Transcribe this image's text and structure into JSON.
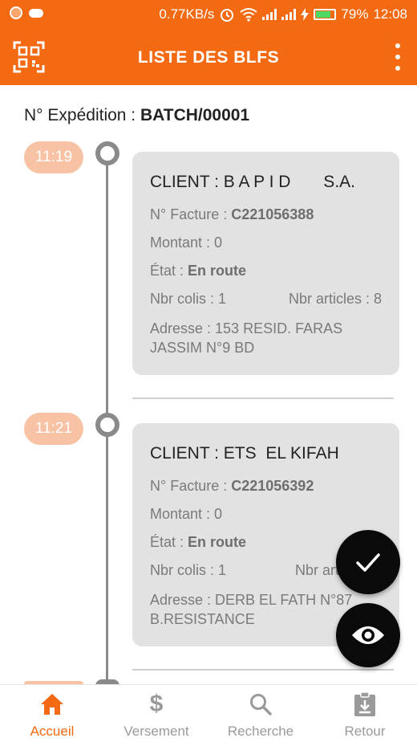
{
  "status_bar": {
    "speed": "0.77KB/s",
    "battery": "79%",
    "time": "12:08"
  },
  "app_bar": {
    "title": "LISTE DES BLFS",
    "qr_icon": "qr-code-icon",
    "menu_icon": "more-vert-icon"
  },
  "header": {
    "expedition_label": "N° Expédition : ",
    "expedition_value": "BATCH/00001"
  },
  "entries": [
    {
      "time": "11:19",
      "client": "CLIENT : B A P I D       S.A.",
      "facture_label": "N° Facture : ",
      "facture_value": "C221056388",
      "montant": "Montant : 0",
      "etat_label": "État : ",
      "etat_value": "En route",
      "nbr_colis": "Nbr colis : 1",
      "nbr_articles": "Nbr articles : 8",
      "adresse_line1": "Adresse : 153 RESID. FARAS",
      "adresse_line2": "JASSIM N°9 BD"
    },
    {
      "time": "11:21",
      "client": "CLIENT : ETS  EL KIFAH",
      "facture_label": "N° Facture : ",
      "facture_value": "C221056392",
      "montant": "Montant : 0",
      "etat_label": "État : ",
      "etat_value": "En route",
      "nbr_colis": "Nbr colis : 1",
      "nbr_articles": "Nbr artic",
      "adresse_line1": "Adresse : DERB EL FATH N°87",
      "adresse_line2": "B.RESISTANCE"
    }
  ],
  "fabs": {
    "validate_icon": "check-icon",
    "view_icon": "eye-icon"
  },
  "bottom_nav": {
    "items": [
      {
        "label": "Accueil",
        "icon": "home-icon"
      },
      {
        "label": "Versement",
        "icon": "dollar-icon"
      },
      {
        "label": "Recherche",
        "icon": "search-icon"
      },
      {
        "label": "Retour",
        "icon": "clipboard-return-icon"
      }
    ]
  },
  "colors": {
    "accent": "#f36a12",
    "time_pill": "#f8c2a4",
    "card_bg": "#e2e2e2",
    "fab_bg": "#0a0a0a"
  }
}
